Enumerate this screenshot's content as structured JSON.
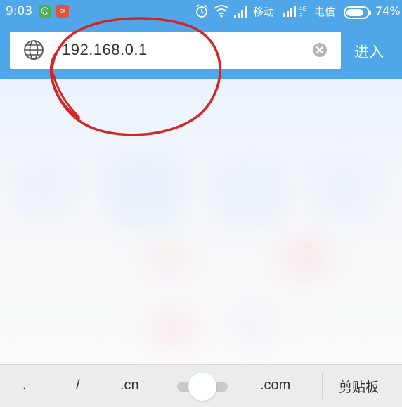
{
  "status_bar": {
    "time": "9:03",
    "carrier_primary": "移动",
    "network_tag": "4G",
    "carrier_secondary": "电信",
    "battery_percent": "74%"
  },
  "address_bar": {
    "url": "192.168.0.1",
    "go_label": "进入"
  },
  "keyboard_bar": {
    "keys": [
      ".",
      "/",
      ".cn",
      ".com"
    ],
    "clipboard_label": "剪贴板"
  },
  "colors": {
    "header": "#4fa6e8",
    "annotation_circle": "#d32626",
    "url_text": "#333333"
  },
  "icons": [
    "globe-icon",
    "clear-icon",
    "alarm-icon",
    "wifi-icon",
    "signal-icon",
    "battery-icon"
  ]
}
